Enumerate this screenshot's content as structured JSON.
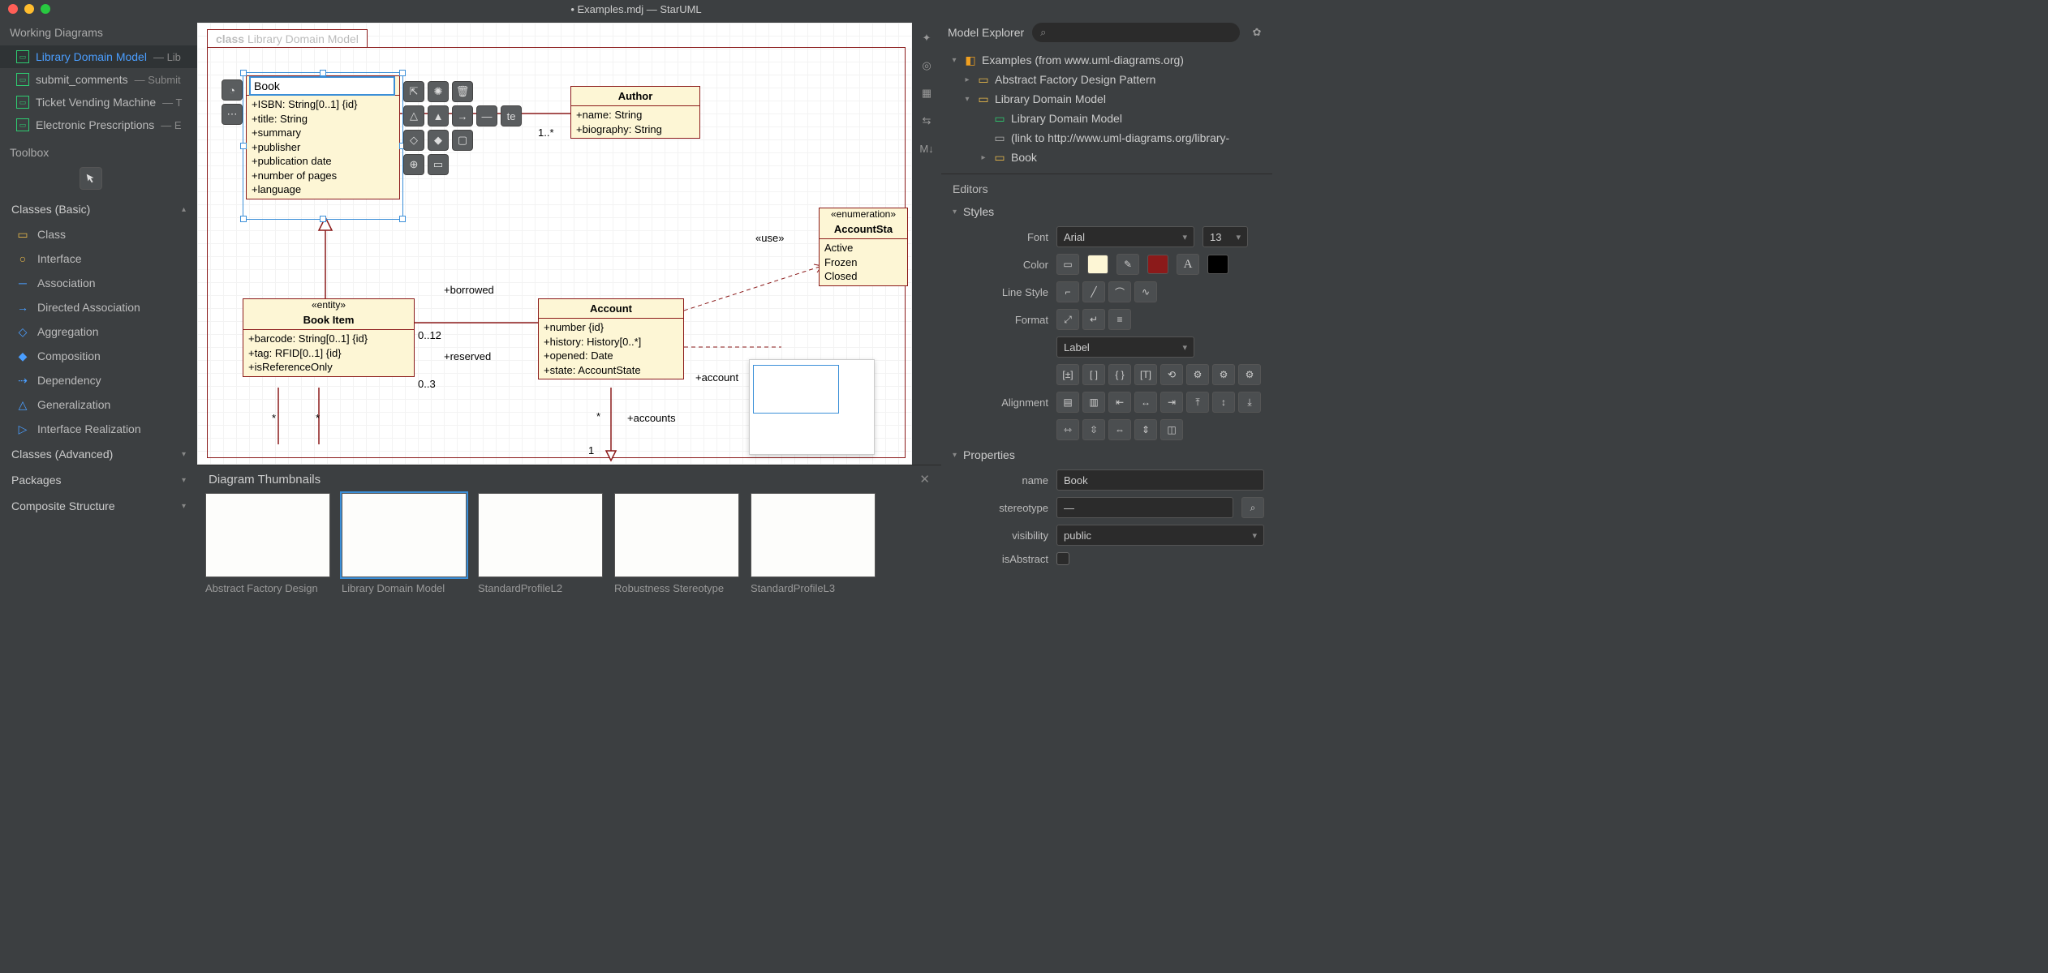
{
  "window": {
    "title": "• Examples.mdj — StarUML"
  },
  "leftPanel": {
    "workingDiagramsTitle": "Working Diagrams",
    "diagrams": [
      {
        "label": "Library Domain Model",
        "sub": "— Lib",
        "active": true
      },
      {
        "label": "submit_comments",
        "sub": "— Submit",
        "active": false
      },
      {
        "label": "Ticket Vending Machine",
        "sub": "— T",
        "active": false
      },
      {
        "label": "Electronic Prescriptions",
        "sub": "— E",
        "active": false
      }
    ],
    "toolboxTitle": "Toolbox",
    "sections": {
      "basic": "Classes (Basic)",
      "advanced": "Classes (Advanced)",
      "packages": "Packages",
      "composite": "Composite Structure"
    },
    "items": [
      {
        "label": "Class",
        "icon": "class"
      },
      {
        "label": "Interface",
        "icon": "interface"
      },
      {
        "label": "Association",
        "icon": "assoc"
      },
      {
        "label": "Directed Association",
        "icon": "dassoc"
      },
      {
        "label": "Aggregation",
        "icon": "agg"
      },
      {
        "label": "Composition",
        "icon": "comp"
      },
      {
        "label": "Dependency",
        "icon": "dep"
      },
      {
        "label": "Generalization",
        "icon": "gen"
      },
      {
        "label": "Interface Realization",
        "icon": "real"
      }
    ]
  },
  "canvas": {
    "frameLabel": {
      "kind": "class",
      "name": "Library Domain Model"
    },
    "editValue": "Book",
    "book": {
      "name": "Book",
      "attrs": [
        "+ISBN: String[0..1] {id}",
        "+title: String",
        "+summary",
        "+publisher",
        "+publication date",
        "+number of pages",
        "+language"
      ]
    },
    "author": {
      "name": "Author",
      "attrs": [
        "+name: String",
        "+biography: String"
      ]
    },
    "bookItem": {
      "stereo": "«entity»",
      "name": "Book Item",
      "attrs": [
        "+barcode: String[0..1] {id}",
        "+tag: RFID[0..1] {id}",
        "+isReferenceOnly"
      ]
    },
    "account": {
      "name": "Account",
      "attrs": [
        "+number {id}",
        "+history: History[0..*]",
        "+opened: Date",
        "+state: AccountState"
      ]
    },
    "enum": {
      "stereo": "«enumeration»",
      "name": "AccountSta",
      "lits": [
        "Active",
        "Frozen",
        "Closed"
      ]
    },
    "labels": {
      "oneStar": "1..*",
      "use": "«use»",
      "borrowed": "+borrowed",
      "reserved": "+reserved",
      "n012": "0..12",
      "n03": "0..3",
      "starL": "*",
      "starR": "*",
      "accStar": "*",
      "accounts": "+accounts",
      "accOne": "1",
      "accountRole": "+account"
    }
  },
  "thumbnails": {
    "title": "Diagram Thumbnails",
    "items": [
      {
        "label": "Abstract Factory Design",
        "active": false
      },
      {
        "label": "Library Domain Model",
        "active": true
      },
      {
        "label": "StandardProfileL2",
        "active": false
      },
      {
        "label": "Robustness Stereotype",
        "active": false
      },
      {
        "label": "StandardProfileL3",
        "active": false
      }
    ]
  },
  "modelExplorer": {
    "title": "Model Explorer",
    "root": "Examples (from www.uml-diagrams.org)",
    "n1": "Abstract Factory Design Pattern",
    "n2": "Library Domain Model",
    "n2a": "Library Domain Model",
    "n2b": "(link to http://www.uml-diagrams.org/library-",
    "n2c": "Book"
  },
  "editors": {
    "title": "Editors",
    "styles": "Styles",
    "fontLabel": "Font",
    "fontName": "Arial",
    "fontSize": "13",
    "colorLabel": "Color",
    "lineStyleLabel": "Line Style",
    "formatLabel": "Format",
    "formatSel": "Label",
    "alignLabel": "Alignment",
    "properties": "Properties",
    "nameLabel": "name",
    "nameVal": "Book",
    "stereoLabel": "stereotype",
    "stereoVal": "—",
    "visLabel": "visibility",
    "visVal": "public",
    "isAbstractLabel": "isAbstract"
  },
  "colors": {
    "fill": "#fdf6d5",
    "stroke": "#8b1a1a",
    "text": "#000000"
  }
}
